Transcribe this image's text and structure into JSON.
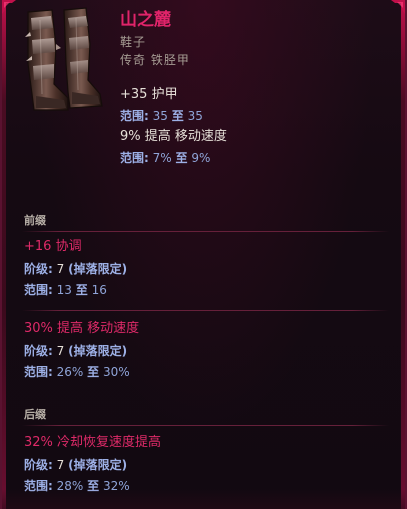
{
  "item": {
    "name": "山之麓",
    "type": "鞋子",
    "rarity": "传奇 铁胫甲",
    "icon": "boots-icon"
  },
  "base_stats": {
    "armor_line": "+35 护甲",
    "armor_range": {
      "label": "范围:",
      "min": "35",
      "connector": "至",
      "max": "35"
    },
    "speed_line": "9% 提高 移动速度",
    "speed_range": {
      "label": "范围:",
      "min": "7%",
      "connector": "至",
      "max": "9%"
    }
  },
  "prefix": {
    "title": "前缀",
    "affixes": [
      {
        "name": "+16 协调",
        "tier_label": "阶级:",
        "tier_value": "7",
        "tier_note": "(掉落限定)",
        "range_label": "范围:",
        "range_min": "13",
        "range_connector": "至",
        "range_max": "16"
      },
      {
        "name": "30% 提高 移动速度",
        "tier_label": "阶级:",
        "tier_value": "7",
        "tier_note": "(掉落限定)",
        "range_label": "范围:",
        "range_min": "26%",
        "range_connector": "至",
        "range_max": "30%"
      }
    ]
  },
  "suffix": {
    "title": "后缀",
    "affixes": [
      {
        "name": "32% 冷却恢复速度提高",
        "tier_label": "阶级:",
        "tier_value": "7",
        "tier_note": "(掉落限定)",
        "range_label": "范围:",
        "range_min": "28%",
        "range_connector": "至",
        "range_max": "32%"
      }
    ]
  },
  "colors": {
    "name": "#e0246a",
    "affix": "#de2a68",
    "range": "#8fa4d8",
    "frame": "#c0104a"
  }
}
